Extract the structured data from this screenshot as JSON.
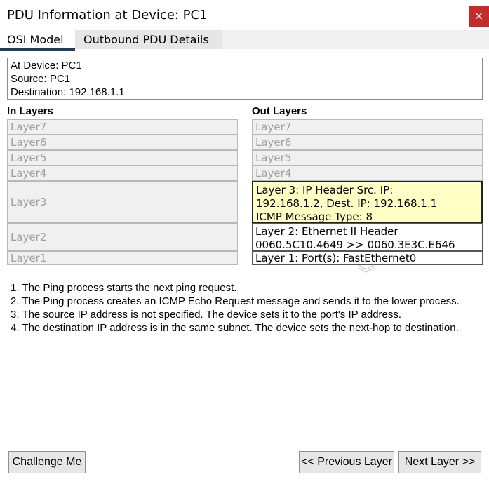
{
  "window": {
    "title": "PDU Information at Device: PC1",
    "close_label": "×"
  },
  "tabs": [
    {
      "label": "OSI Model",
      "selected": true
    },
    {
      "label": "Outbound PDU Details",
      "selected": false
    }
  ],
  "info": {
    "line1": "At Device: PC1",
    "line2": "Source: PC1",
    "line3": "Destination: 192.168.1.1"
  },
  "in_layers": {
    "heading": "In Layers",
    "items": [
      "Layer7",
      "Layer6",
      "Layer5",
      "Layer4",
      "Layer3",
      "Layer2",
      "Layer1"
    ]
  },
  "out_layers": {
    "heading": "Out Layers",
    "items": [
      "Layer7",
      "Layer6",
      "Layer5",
      "Layer4",
      {
        "line1": "Layer 3: IP Header Src. IP:",
        "line2": "192.168.1.2, Dest. IP: 192.168.1.1",
        "line3": "ICMP Message Type: 8"
      },
      {
        "line1": "Layer 2: Ethernet II Header",
        "line2": "0060.5C10.4649 >> 0060.3E3C.E646"
      },
      "Layer 1: Port(s): FastEthernet0"
    ],
    "selected_index": 4
  },
  "steps": [
    "1. The Ping process starts the next ping request.",
    "2. The Ping process creates an ICMP Echo Request message and sends it to the lower process.",
    "3. The source IP address is not specified. The device sets it to the port's IP address.",
    "4. The destination IP address is in the same subnet. The device sets the next-hop to destination."
  ],
  "buttons": {
    "challenge": "Challenge Me",
    "previous": "<< Previous Layer",
    "next": "Next Layer >>"
  },
  "colors": {
    "close_button": "#c52b2b",
    "selected_layer_bg": "#ffffc6",
    "tab_underline": "#1d3e60"
  }
}
